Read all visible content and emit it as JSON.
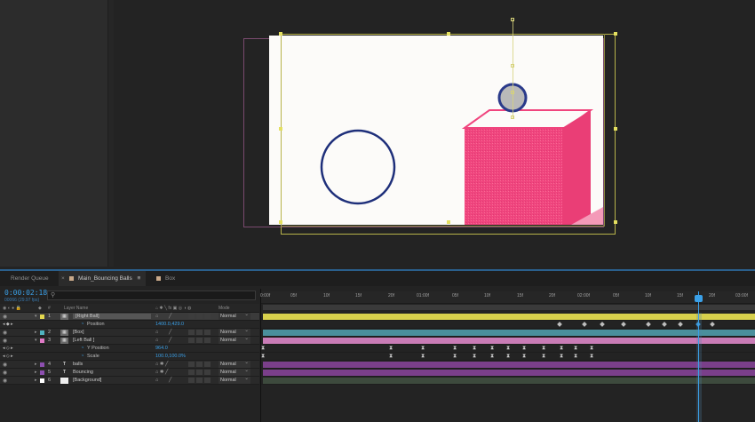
{
  "tabs": [
    {
      "label": "Render Queue",
      "swatch": ""
    },
    {
      "label": "Main_Bouncing Balls",
      "swatch": "#c9a98a",
      "menu": "≡"
    },
    {
      "label": "Box",
      "swatch": "#c9a98a"
    }
  ],
  "timeline": {
    "current_time": "0:00:02:18",
    "frame_sub": "00066 (29.97 fps)",
    "search_icon": "search-icon"
  },
  "columns": {
    "num": "#",
    "layer_name": "Layer Name",
    "mode": "Mode"
  },
  "layers": [
    {
      "num": "1",
      "name": "[Right Ball]",
      "label_color": "#e3d84f",
      "mode": "Normal",
      "selected": true
    },
    {
      "prop": "Position",
      "value": "1400.0,429.0"
    },
    {
      "num": "2",
      "name": "[Box]",
      "label_color": "#4fb3c0",
      "mode": "Normal"
    },
    {
      "num": "3",
      "name": "[Left Ball ]",
      "label_color": "#e07ac6",
      "mode": "Normal"
    },
    {
      "prop": "Y Position",
      "value": "964.0"
    },
    {
      "prop": "Scale",
      "value": "100.0,100.0%"
    },
    {
      "num": "4",
      "name": "balls",
      "label_color": "#8d4fb0",
      "mode": "Normal",
      "text": true
    },
    {
      "num": "5",
      "name": "Bouncing",
      "label_color": "#8d4fb0",
      "mode": "Normal",
      "text": true
    },
    {
      "num": "6",
      "name": "[Background]",
      "label_color": "#ffffff",
      "mode": "Normal"
    }
  ],
  "ruler": [
    "0:00f",
    "05f",
    "10f",
    "15f",
    "20f",
    "01:00f",
    "05f",
    "10f",
    "15f",
    "20f",
    "02:00f",
    "05f",
    "10f",
    "15f",
    "20f",
    "03:00f"
  ],
  "colors": {
    "accent": "#3aa0e8",
    "ball_outline": "#1e2f7a",
    "box": "#f0457e",
    "layer1_bar": "#d7d04c",
    "layer2_bar": "#4a8f9c",
    "layer3_bar": "#c97cb6",
    "text_bar": "#7a3f8a"
  }
}
